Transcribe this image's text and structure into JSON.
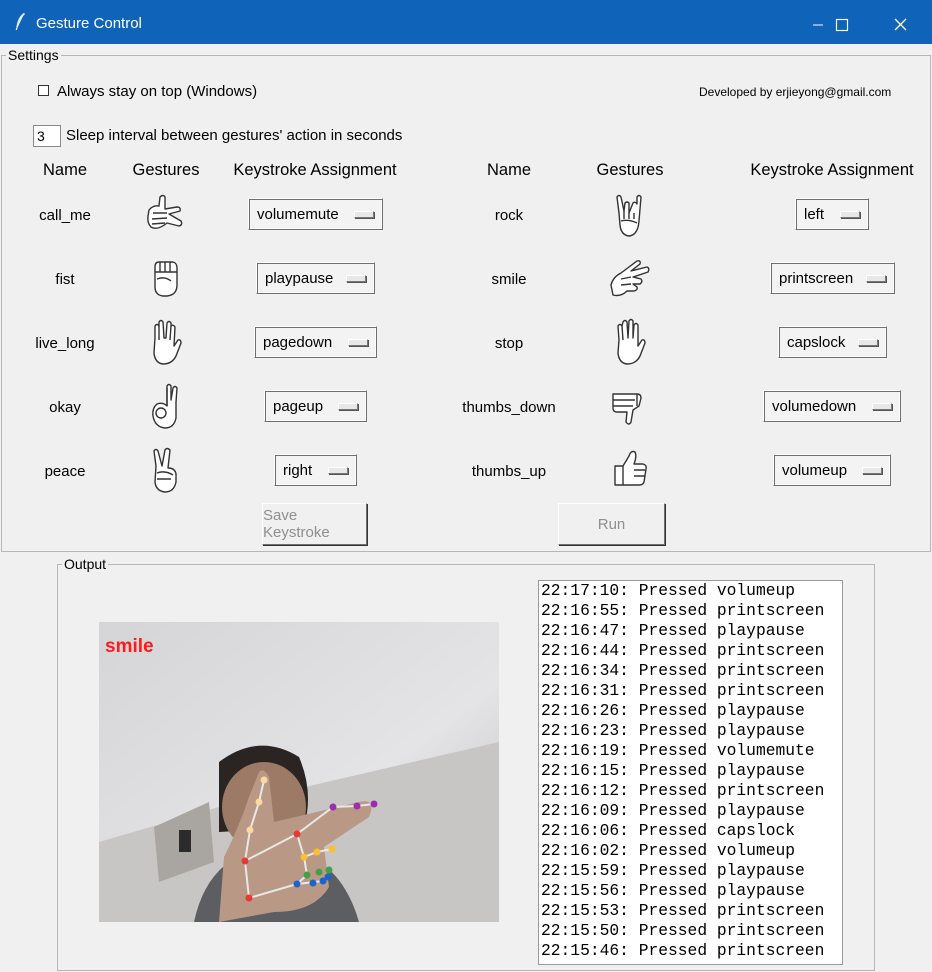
{
  "window": {
    "title": "Gesture Control"
  },
  "settings": {
    "legend": "Settings",
    "always_on_top_label": "Always stay on top (Windows)",
    "always_on_top_checked": false,
    "developer_credit": "Developed by erjieyong@gmail.com",
    "sleep_interval_value": "3",
    "sleep_interval_label": "Sleep interval between gestures' action in seconds",
    "headers": {
      "name": "Name",
      "gestures": "Gestures",
      "keystroke": "Keystroke Assignment"
    },
    "left_gestures": [
      {
        "name": "call_me",
        "icon": "call-me-hand-icon",
        "keystroke": "volumemute"
      },
      {
        "name": "fist",
        "icon": "fist-hand-icon",
        "keystroke": "playpause"
      },
      {
        "name": "live_long",
        "icon": "live-long-hand-icon",
        "keystroke": "pagedown"
      },
      {
        "name": "okay",
        "icon": "okay-hand-icon",
        "keystroke": "pageup"
      },
      {
        "name": "peace",
        "icon": "peace-hand-icon",
        "keystroke": "right"
      }
    ],
    "right_gestures": [
      {
        "name": "rock",
        "icon": "rock-hand-icon",
        "keystroke": "left"
      },
      {
        "name": "smile",
        "icon": "smile-hand-icon",
        "keystroke": "printscreen"
      },
      {
        "name": "stop",
        "icon": "stop-hand-icon",
        "keystroke": "capslock"
      },
      {
        "name": "thumbs_down",
        "icon": "thumbs-down-hand-icon",
        "keystroke": "volumedown"
      },
      {
        "name": "thumbs_up",
        "icon": "thumbs-up-hand-icon",
        "keystroke": "volumeup"
      }
    ],
    "save_button": "Save Keystroke",
    "run_button": "Run"
  },
  "output": {
    "legend": "Output",
    "camera_label": "smile",
    "camera_label_color": "#ff1a1a",
    "log": [
      "22:17:10: Pressed volumeup",
      "22:16:55: Pressed printscreen",
      "22:16:47: Pressed playpause",
      "22:16:44: Pressed printscreen",
      "22:16:34: Pressed printscreen",
      "22:16:31: Pressed printscreen",
      "22:16:26: Pressed playpause",
      "22:16:23: Pressed playpause",
      "22:16:19: Pressed volumemute",
      "22:16:15: Pressed playpause",
      "22:16:12: Pressed printscreen",
      "22:16:09: Pressed playpause",
      "22:16:06: Pressed capslock",
      "22:16:02: Pressed volumeup",
      "22:15:59: Pressed playpause",
      "22:15:56: Pressed playpause",
      "22:15:53: Pressed printscreen",
      "22:15:50: Pressed printscreen",
      "22:15:46: Pressed printscreen"
    ]
  },
  "colors": {
    "titlebar": "#0f63b8",
    "window_bg": "#f0f0f0"
  }
}
